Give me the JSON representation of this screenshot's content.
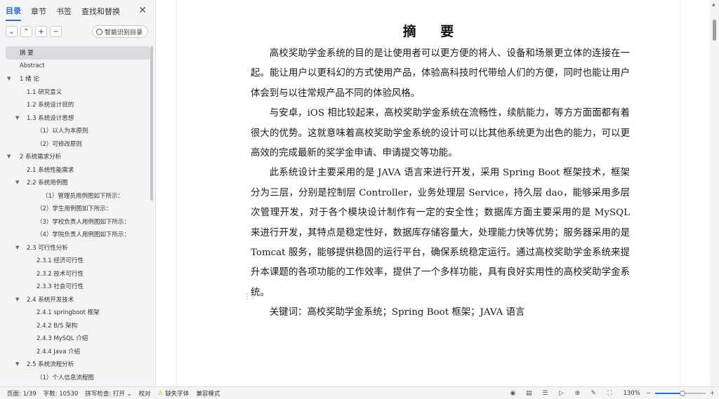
{
  "sidebar": {
    "tabs": [
      "目录",
      "章节",
      "书签",
      "查找和替换"
    ],
    "close_label": "✕",
    "toolbar": {
      "collapse_label": "⌄",
      "expand_label": "⌃",
      "add_label": "+",
      "remove_label": "−",
      "smart_label": "智能识别目录"
    },
    "toc": [
      {
        "label": "摘  要",
        "level": 0,
        "caret": ""
      },
      {
        "label": "Abstract",
        "level": 0,
        "caret": ""
      },
      {
        "label": "1 绪  论",
        "level": 0,
        "caret": "▼"
      },
      {
        "label": "1.1 研究意义",
        "level": 1,
        "caret": ""
      },
      {
        "label": "1.2 系统设计目的",
        "level": 1,
        "caret": ""
      },
      {
        "label": "1.3 系统设计思想",
        "level": 1,
        "caret": "▼"
      },
      {
        "label": "（1）以人为本原则",
        "level": 2,
        "caret": ""
      },
      {
        "label": "（2）可修改原则",
        "level": 2,
        "caret": ""
      },
      {
        "label": "2 系统需求分析",
        "level": 0,
        "caret": "▼"
      },
      {
        "label": "2.1 系统性能需求",
        "level": 1,
        "caret": ""
      },
      {
        "label": "2.2 系统用例图",
        "level": 1,
        "caret": "▼"
      },
      {
        "label": "（1）管理员用例图如下所示：",
        "level": 3,
        "caret": ""
      },
      {
        "label": "（2）学生用例图如下所示：",
        "level": 2,
        "caret": ""
      },
      {
        "label": "（3）学校负责人用例图如下所示：",
        "level": 2,
        "caret": ""
      },
      {
        "label": "（4）学院负责人用例图如下所示：",
        "level": 2,
        "caret": ""
      },
      {
        "label": "2.3 可行性分析",
        "level": 1,
        "caret": "▼"
      },
      {
        "label": "2.3.1 经济可行性",
        "level": 2,
        "caret": ""
      },
      {
        "label": "2.3.2 技术可行性",
        "level": 2,
        "caret": ""
      },
      {
        "label": "2.3.3 社会可行性",
        "level": 2,
        "caret": ""
      },
      {
        "label": "2.4 系统开发技术",
        "level": 1,
        "caret": "▼"
      },
      {
        "label": "2.4.1  springboot 框架",
        "level": 2,
        "caret": ""
      },
      {
        "label": "2.4.2  B/S 架构",
        "level": 2,
        "caret": ""
      },
      {
        "label": "2.4.3 MySQL 介绍",
        "level": 2,
        "caret": ""
      },
      {
        "label": "2.4.4 Java 介绍",
        "level": 2,
        "caret": ""
      },
      {
        "label": "2.5 系统流程分析",
        "level": 1,
        "caret": "▼"
      },
      {
        "label": "（1）个人信息流程图",
        "level": 2,
        "caret": ""
      }
    ]
  },
  "document": {
    "title": "摘  要",
    "paragraphs": [
      "高校奖助学金系统的目的是让使用者可以更方便的将人、设备和场景更立体的连接在一起。能让用户以更科幻的方式使用产品，体验高科技时代带给人们的方便，同时也能让用户体会到与以往常规产品不同的体验风格。",
      "与安卓，iOS 相比较起来，高校奖助学金系统在流畅性，续航能力，等方方面面都有着很大的优势。这就意味着高校奖助学金系统的设计可以比其他系统更为出色的能力，可以更高效的完成最新的奖学金申请、申请提交等功能。",
      "此系统设计主要采用的是 JAVA 语言来进行开发，采用 Spring Boot 框架技术，框架分为三层，分别是控制层 Controller，业务处理层 Service，持久层 dao，能够采用多层次管理开发，对于各个模块设计制作有一定的安全性；数据库方面主要采用的是 MySQL 来进行开发，其特点是稳定性好，数据库存储容量大，处理能力快等优势；服务器采用的是 Tomcat 服务，能够提供稳固的运行平台，确保系统稳定运行。通过高校奖助学金系统来提升本课题的各项功能的工作效率，提供了一个多样功能，具有良好实用性的高校奖助学金系统。"
    ],
    "keywords": "关键词：高校奖助学金系统；Spring Boot 框架；JAVA 语言"
  },
  "statusbar": {
    "page": "页面: 1/39",
    "word_count": "字数: 10530",
    "spell_check": "拼写检查: 打开 ⌄",
    "proofread": "校对",
    "missing_font": "缺失字体",
    "compat_mode": "兼容模式",
    "zoom": "130%",
    "zoom_fraction": 0.55
  },
  "icons": {
    "view": "eye-icon",
    "page_view": "page-view-icon",
    "list": "list-icon",
    "play": "play-icon",
    "web": "globe-icon",
    "pen": "pen-icon",
    "fit": "fit-icon"
  }
}
